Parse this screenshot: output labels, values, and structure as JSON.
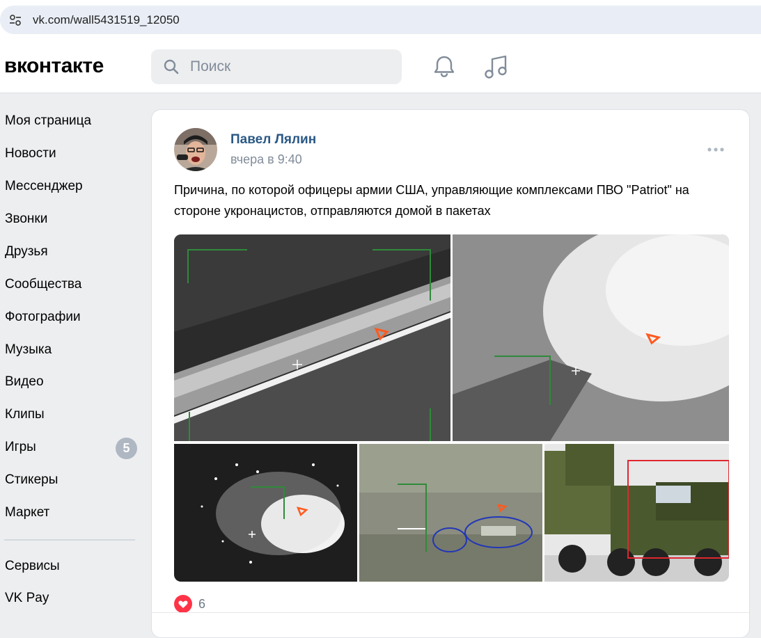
{
  "browser": {
    "url": "vk.com/wall5431519_12050"
  },
  "header": {
    "logo": "вконтакте",
    "search_placeholder": "Поиск"
  },
  "sidebar": {
    "items": [
      {
        "label": "Моя страница"
      },
      {
        "label": "Новости"
      },
      {
        "label": "Мессенджер"
      },
      {
        "label": "Звонки"
      },
      {
        "label": "Друзья"
      },
      {
        "label": "Сообщества"
      },
      {
        "label": "Фотографии"
      },
      {
        "label": "Музыка"
      },
      {
        "label": "Видео"
      },
      {
        "label": "Клипы"
      },
      {
        "label": "Игры",
        "badge": "5"
      },
      {
        "label": "Стикеры"
      },
      {
        "label": "Маркет"
      }
    ],
    "secondary": [
      {
        "label": "Сервисы"
      },
      {
        "label": "VK Pay"
      }
    ]
  },
  "post": {
    "author": "Павел Лялин",
    "time": "вчера в 9:40",
    "text": "Причина, по которой офицеры армии США, управляющие комплексами ПВО \"Patriot\" на стороне укронацистов, отправляются домой в пакетах",
    "likes": "6"
  },
  "colors": {
    "link": "#2a5885",
    "secondary_text": "#818c99",
    "like_red": "#ff3347",
    "badge": "#aeb7c2"
  }
}
